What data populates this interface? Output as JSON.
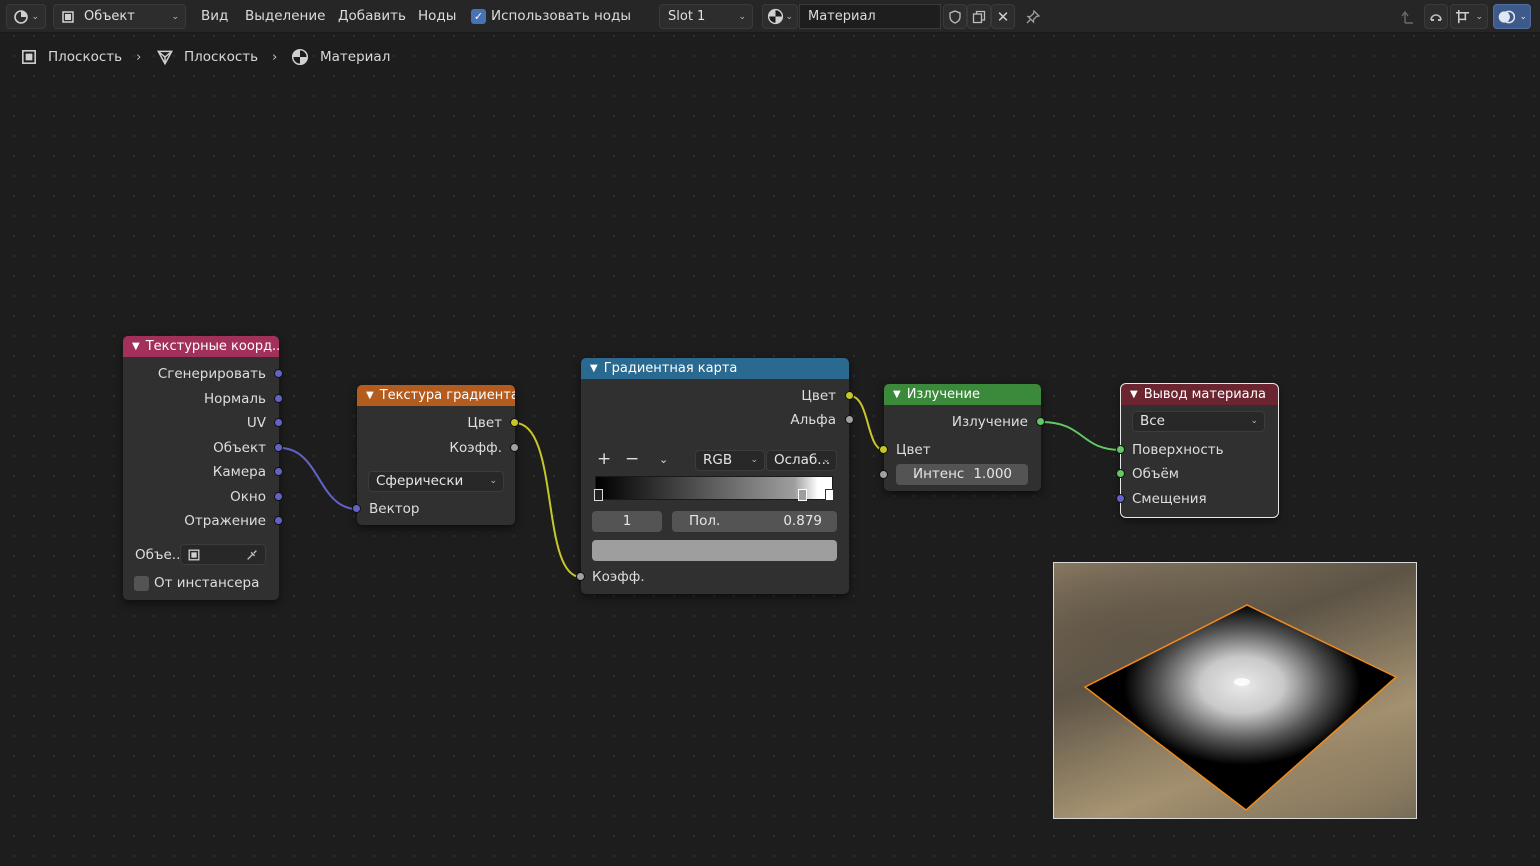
{
  "header": {
    "editor_type_icon": "node-editor-icon",
    "mode_label": "Объект",
    "menu": [
      "Вид",
      "Выделение",
      "Добавить",
      "Ноды"
    ],
    "use_nodes_label": "Использовать ноды",
    "use_nodes_checked": true,
    "slot_label": "Slot 1",
    "material_name": "Материал",
    "right_icons": [
      "parent-arrow-icon",
      "snap-icon",
      "overlay-icon",
      "xray-icon"
    ]
  },
  "breadcrumb": {
    "items": [
      "Плоскость",
      "Плоскость",
      "Материал"
    ]
  },
  "nodes": {
    "texcoord": {
      "title": "Текстурные коорд...",
      "color": "#a1315a",
      "outputs": [
        "Сгенерировать",
        "Нормаль",
        "UV",
        "Объект",
        "Камера",
        "Окно",
        "Отражение"
      ],
      "object_label": "Объе...",
      "from_instancer_label": "От инстансера"
    },
    "gradient_texture": {
      "title": "Текстура градиента",
      "color": "#b35c1e",
      "outputs": [
        "Цвет",
        "Коэфф."
      ],
      "type_value": "Сферически",
      "input_label": "Вектор"
    },
    "color_ramp": {
      "title": "Градиентная карта",
      "color": "#2b6a90",
      "outputs": [
        "Цвет",
        "Альфа"
      ],
      "add_label": "+",
      "remove_label": "−",
      "color_mode": "RGB",
      "interpolation": "Ослаб...",
      "active_index": "1",
      "pos_label": "Пол.",
      "pos_value": "0.879",
      "input_label": "Коэфф."
    },
    "emission": {
      "title": "Излучение",
      "color": "#3b8a3b",
      "output_label": "Излучение",
      "color_input": "Цвет",
      "strength_label": "Интенс",
      "strength_value": "1.000"
    },
    "material_output": {
      "title": "Вывод материала",
      "color": "#6b2530",
      "target": "Все",
      "inputs": [
        "Поверхность",
        "Объём",
        "Смещения"
      ]
    }
  },
  "links_colors": {
    "vector": "#6363c7",
    "color": "#c7c729",
    "float": "#a1a1a1",
    "shader": "#63c763"
  }
}
